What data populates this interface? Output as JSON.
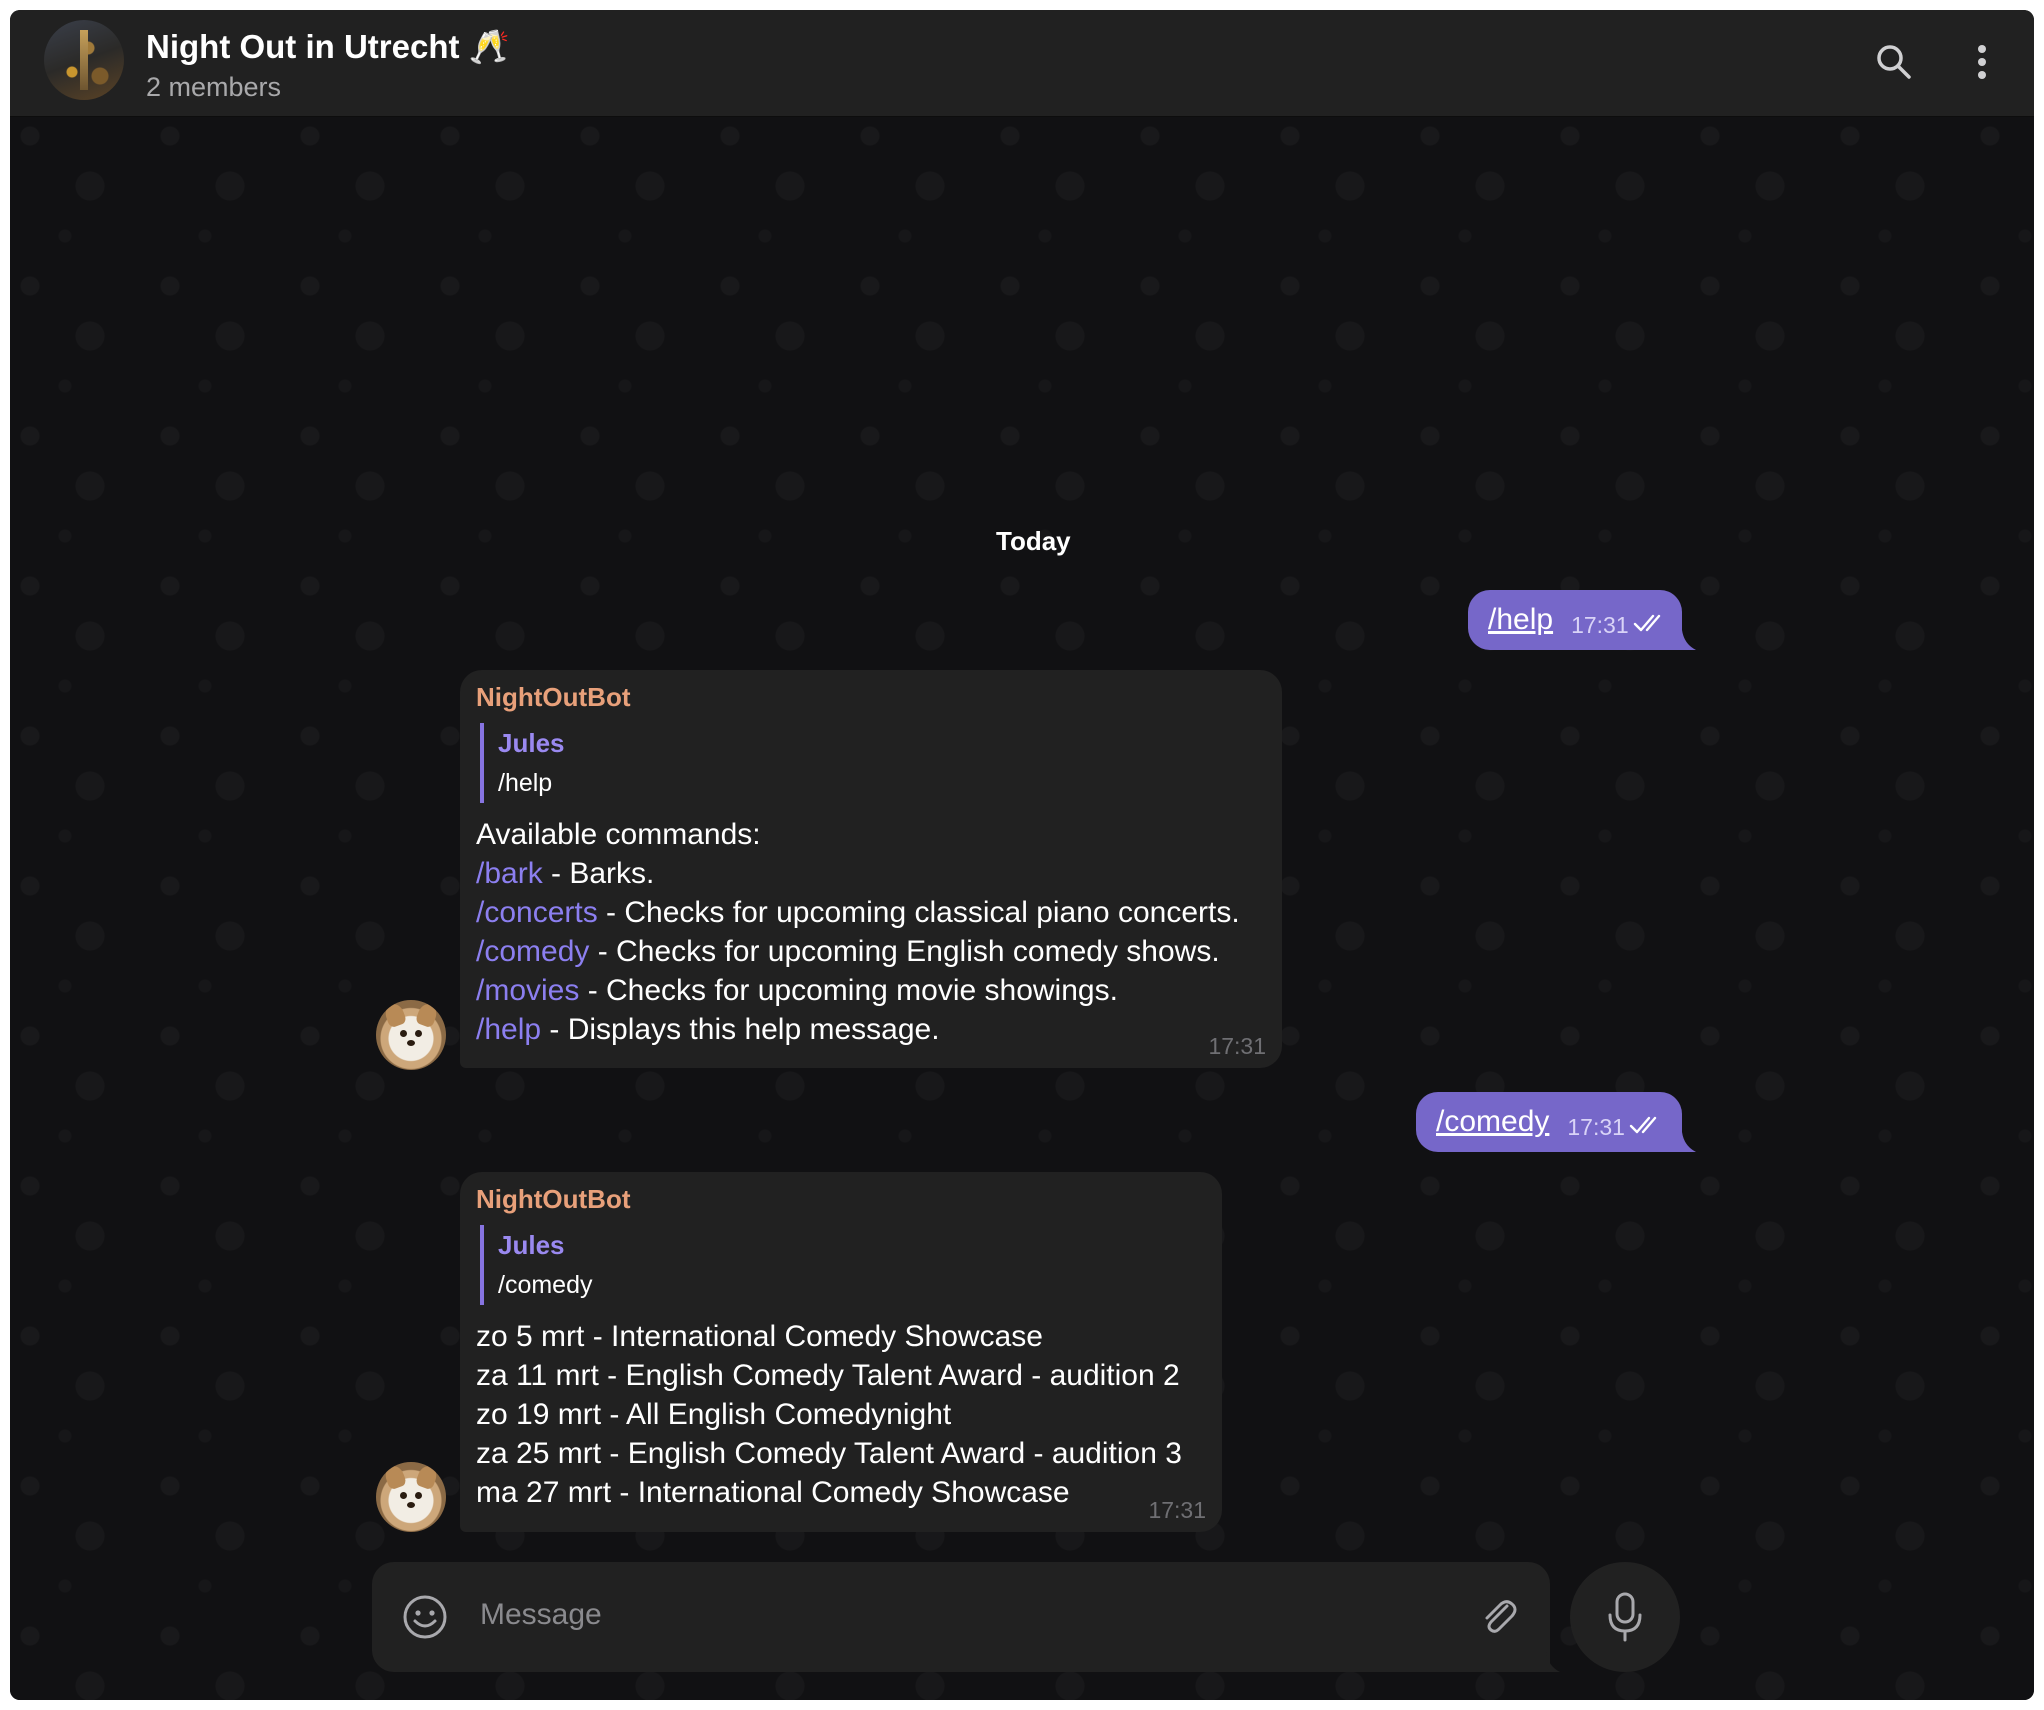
{
  "header": {
    "title": "Night Out in Utrecht 🥂",
    "subtitle": "2 members",
    "search_icon": "search-icon",
    "menu_icon": "more-vertical-icon"
  },
  "date_separator": "Today",
  "messages": [
    {
      "direction": "out",
      "text": "/help",
      "time": "17:31",
      "status": "read"
    },
    {
      "direction": "in",
      "sender": "NightOutBot",
      "reply_to": {
        "name": "Jules",
        "text": "/help"
      },
      "lines": [
        {
          "link": "",
          "text": "Available commands:"
        },
        {
          "link": "/bark",
          "text": " - Barks."
        },
        {
          "link": "/concerts",
          "text": " - Checks for upcoming classical piano concerts."
        },
        {
          "link": "/comedy",
          "text": " - Checks for upcoming English comedy shows."
        },
        {
          "link": "/movies",
          "text": " - Checks for upcoming movie showings."
        },
        {
          "link": "/help",
          "text": " - Displays this help message."
        }
      ],
      "time": "17:31"
    },
    {
      "direction": "out",
      "text": "/comedy",
      "time": "17:31",
      "status": "read"
    },
    {
      "direction": "in",
      "sender": "NightOutBot",
      "reply_to": {
        "name": "Jules",
        "text": "/comedy"
      },
      "lines": [
        {
          "link": "",
          "text": "zo 5 mrt - International Comedy Showcase"
        },
        {
          "link": "",
          "text": "za 11 mrt - English Comedy Talent Award - audition 2"
        },
        {
          "link": "",
          "text": "zo 19 mrt - All English Comedynight"
        },
        {
          "link": "",
          "text": "za 25 mrt - English Comedy Talent Award - audition 3"
        },
        {
          "link": "",
          "text": "ma 27 mrt - International Comedy Showcase"
        }
      ],
      "time": "17:31"
    }
  ],
  "composer": {
    "placeholder": "Message",
    "emoji_icon": "smile-icon",
    "attach_icon": "paperclip-icon",
    "mic_icon": "microphone-icon"
  },
  "colors": {
    "accent": "#7667c9",
    "link": "#8c7ff0",
    "sender": "#e8a07a",
    "panel": "#212121",
    "background": "#111113"
  }
}
